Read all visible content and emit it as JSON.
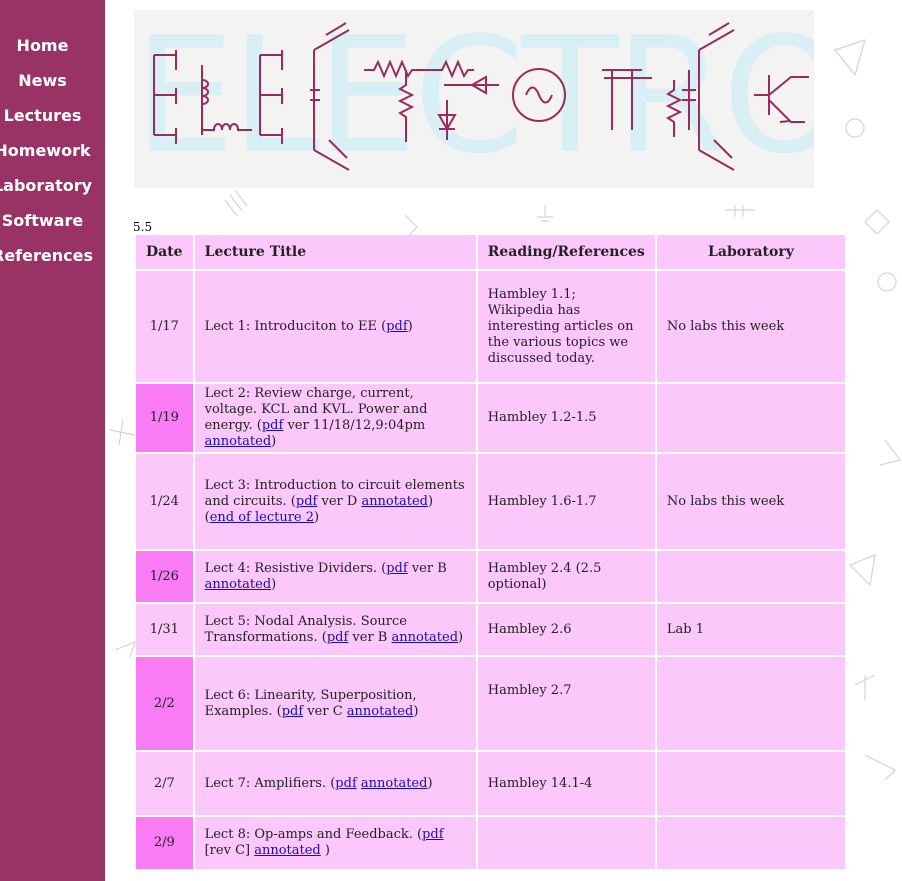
{
  "nav": {
    "items": [
      {
        "label": "Home"
      },
      {
        "label": "News"
      },
      {
        "label": "Lectures"
      },
      {
        "label": "Homework"
      },
      {
        "label": "Laboratory"
      },
      {
        "label": "Software"
      },
      {
        "label": "References"
      }
    ]
  },
  "banner": {
    "title": "ELECTRONICS"
  },
  "page_marker": "5.5",
  "table": {
    "headers": {
      "date": "Date",
      "title": "Lecture Title",
      "reading": "Reading/References",
      "lab": "Laboratory"
    },
    "rows": [
      {
        "date": "1/17",
        "title_pre": "Lect 1: Introduciton to EE (",
        "link1": "pdf",
        "title_post": ")",
        "reading": "Hambley 1.1; Wikipedia has interesting articles on the various topics we discussed today.",
        "lab": "No labs this week"
      },
      {
        "date": "1/19",
        "title_pre": "Lect 2: Review charge, current, voltage. KCL and KVL. Power and energy. (",
        "link1": "pdf",
        "title_mid": " ver 11/18/12,9:04pm ",
        "link2": "annotated",
        "title_post": ")",
        "reading": "Hambley 1.2-1.5",
        "lab": ""
      },
      {
        "date": "1/24",
        "title_pre": "Lect 3: Introduction to circuit elements and circuits. (",
        "link1": "pdf",
        "title_mid": " ver D ",
        "link2": "annotated",
        "title_mid2": ") (",
        "link3": "end of lecture 2",
        "title_post": ")",
        "reading": "Hambley 1.6-1.7",
        "lab": "No labs this week"
      },
      {
        "date": "1/26",
        "title_pre": "Lect 4: Resistive Dividers. (",
        "link1": "pdf",
        "title_mid": " ver B ",
        "link2": "annotated",
        "title_post": ")",
        "reading": "Hambley 2.4 (2.5 optional)",
        "lab": ""
      },
      {
        "date": "1/31",
        "title_pre": "Lect 5: Nodal Analysis. Source Transformations. (",
        "link1": "pdf",
        "title_mid": " ver B ",
        "link2": "annotated",
        "title_post": ")",
        "reading": "Hambley 2.6",
        "lab": "Lab 1"
      },
      {
        "date": "2/2",
        "title_pre": "Lect 6: Linearity, Superposition, Examples. (",
        "link1": "pdf",
        "title_mid": " ver C ",
        "link2": "annotated",
        "title_post": ")",
        "reading": "Hambley 2.7",
        "lab": ""
      },
      {
        "date": "2/7",
        "title_pre": "Lect 7: Amplifiers. (",
        "link1": "pdf",
        "title_mid": " ",
        "link2": "annotated",
        "title_post": ")",
        "reading": "Hambley 14.1-4",
        "lab": ""
      },
      {
        "date": "2/9",
        "title_pre": "Lect 8: Op-amps and Feedback. (",
        "link1": "pdf",
        "title_mid": " [rev C] ",
        "link2": "annotated",
        "title_post": " )",
        "reading": "",
        "lab": ""
      }
    ]
  },
  "colors": {
    "sidebar": "#993366",
    "cell": "#fcc8fc",
    "date_alt": "#fa7cf5",
    "banner_circuit": "#9b2a5e",
    "banner_letters": "#d8f0f5",
    "link": "#1a0dab"
  }
}
